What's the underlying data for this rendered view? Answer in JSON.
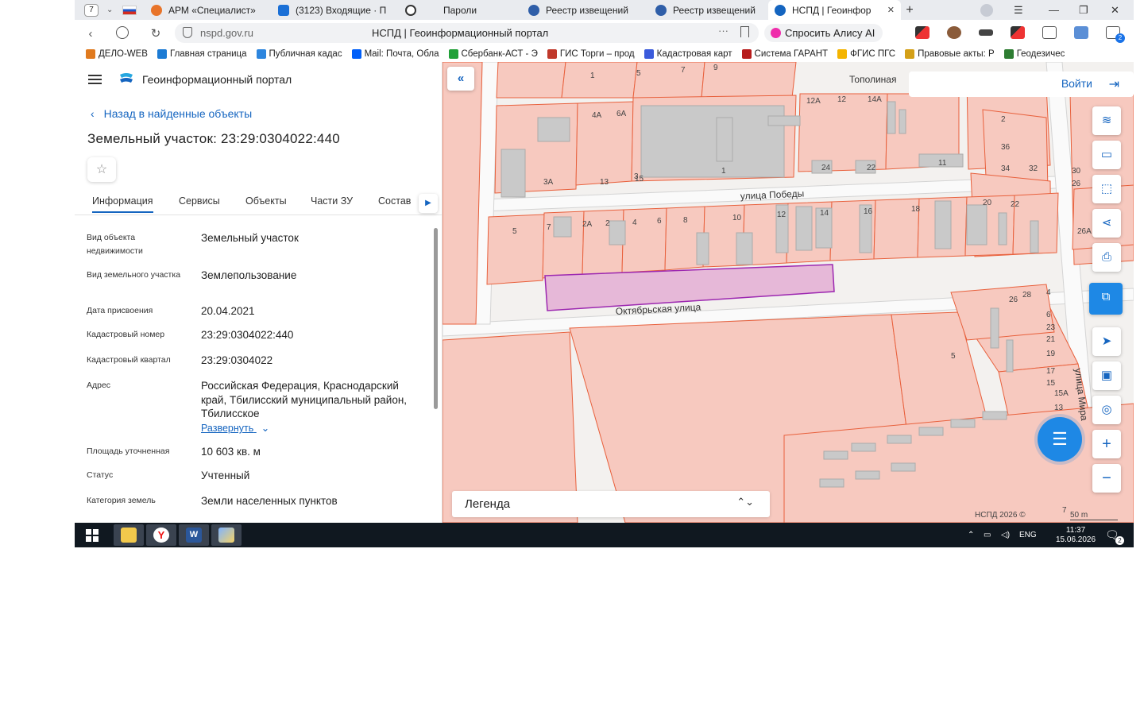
{
  "browser": {
    "tab_count": "7",
    "tabs": [
      {
        "label": "АРМ «Специалист»",
        "color": "#e8742a"
      },
      {
        "label": "(3123) Входящие · П",
        "color": "#1a6fd6"
      },
      {
        "label": "Пароли",
        "color": "#333333"
      },
      {
        "label": "Реестр извещений",
        "color": "#2f5ea8"
      },
      {
        "label": "Реестр извещений",
        "color": "#2f5ea8"
      },
      {
        "label": "НСПД | Геоинфор",
        "color": "#1565c0"
      }
    ],
    "url": "nspd.gov.ru",
    "page_title": "НСПД | Геоинформационный портал",
    "alisa_label": "Спросить Алису AI",
    "notification_count": "2"
  },
  "bookmarks": [
    {
      "label": "ДЕЛО-WEB",
      "color": "#e07a1f"
    },
    {
      "label": "Главная страница",
      "color": "#1c7bd4"
    },
    {
      "label": "Публичная кадас",
      "color": "#2e86de"
    },
    {
      "label": "Mail: Почта, Обла",
      "color": "#005ff9"
    },
    {
      "label": "Сбербанк-АСТ - Э",
      "color": "#21a038"
    },
    {
      "label": "ГИС Торги – прод",
      "color": "#c0392b"
    },
    {
      "label": "Кадастровая карт",
      "color": "#3b5bdb"
    },
    {
      "label": "Система ГАРАНТ",
      "color": "#b71c1c"
    },
    {
      "label": "ФГИС ПГС",
      "color": "#f4b400"
    },
    {
      "label": "Правовые акты: Р",
      "color": "#d4a017"
    },
    {
      "label": "Геодезичес",
      "color": "#2e7d32"
    }
  ],
  "sidebar": {
    "portal_name": "Геоинформационный портал",
    "back_link": "Назад в найденные объекты",
    "object_title": "Земельный участок: 23:29:0304022:440",
    "tabs": [
      "Информация",
      "Сервисы",
      "Объекты",
      "Части ЗУ",
      "Состав"
    ],
    "expand_link": "Развернуть",
    "fields": [
      {
        "label": "Вид объекта недвижимости",
        "value": "Земельный участок"
      },
      {
        "label": "Вид земельного участка",
        "value": "Землепользование"
      },
      {
        "label": "Дата присвоения",
        "value": "20.04.2021"
      },
      {
        "label": "Кадастровый номер",
        "value": "23:29:0304022:440"
      },
      {
        "label": "Кадастровый квартал",
        "value": "23:29:0304022"
      },
      {
        "label": "Адрес",
        "value": "Российская Федерация, Краснодарский край, Тбилисский муниципальный район, Тбилисское"
      },
      {
        "label": "Площадь уточненная",
        "value": "10 603 кв. м"
      },
      {
        "label": "Статус",
        "value": "Учтенный"
      },
      {
        "label": "Категория земель",
        "value": "Земли населенных пунктов"
      }
    ]
  },
  "map": {
    "login_label": "Войти",
    "legend_label": "Легенда",
    "copyright": "НСПД 2026 ©",
    "scale": "50 m",
    "streets": [
      "Тополиная",
      "улица Победы",
      "Октябрьская улица",
      "улица Мира"
    ],
    "parcel_labels": [
      "1",
      "5",
      "7",
      "9",
      "12А",
      "12",
      "14А",
      "4А",
      "6А",
      "2",
      "36",
      "34",
      "32",
      "30",
      "26",
      "24",
      "22",
      "11",
      "13",
      "15",
      "3А",
      "3",
      "1",
      "5",
      "7",
      "2А",
      "2",
      "4",
      "6",
      "8",
      "10",
      "12",
      "14",
      "16",
      "18",
      "20",
      "22",
      "26А",
      "26",
      "28",
      "4",
      "6",
      "23",
      "21",
      "19",
      "17",
      "15",
      "15А",
      "13",
      "11",
      "9",
      "7",
      "5",
      "2"
    ],
    "highlight_color": "#e6b8d8",
    "parcel_color": "#f7c9bf",
    "building_color": "#c9c9c9"
  },
  "taskbar": {
    "lang": "ENG",
    "time": "11:37",
    "date": "15.06.2026",
    "notifications": "2"
  }
}
